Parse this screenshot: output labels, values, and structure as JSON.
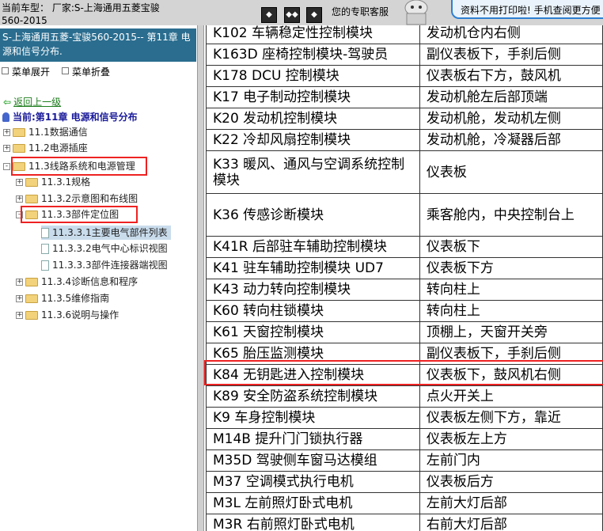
{
  "top_bar": {
    "vehicle_line1": "当前车型：  厂家:S-上海通用五菱宝骏",
    "vehicle_line2": "560-2015",
    "nav_buttons": [
      "first-page-icon",
      "prev-next-icon",
      "last-page-icon"
    ],
    "slogan": "您的专职客服",
    "promo_text": "资料不用打印啦! 手机查阅更方便"
  },
  "left_panel": {
    "chapter_title": "S-上海通用五菱-宝骏560-2015-- 第11章 电源和信号分布.",
    "expand_label": "菜单展开",
    "collapse_label": "菜单折叠",
    "back_label": "返回上一级",
    "current_label": "当前:第11章 电源和信号分布",
    "tree": [
      {
        "label": "11.1数据通信",
        "level": 0,
        "toggle": "+"
      },
      {
        "label": "11.2电源插座",
        "level": 0,
        "toggle": "+"
      },
      {
        "label": "11.3线路系统和电源管理",
        "level": 0,
        "toggle": "-"
      },
      {
        "label": "11.3.1规格",
        "level": 1,
        "toggle": "+"
      },
      {
        "label": "11.3.2示意图和布线图",
        "level": 1,
        "toggle": "+"
      },
      {
        "label": "11.3.3部件定位图",
        "level": 1,
        "toggle": "-"
      },
      {
        "label": "11.3.3.1主要电气部件列表",
        "level": 2,
        "toggle": ""
      },
      {
        "label": "11.3.3.2电气中心标识视图",
        "level": 2,
        "toggle": ""
      },
      {
        "label": "11.3.3.3部件连接器端视图",
        "level": 2,
        "toggle": ""
      },
      {
        "label": "11.3.4诊断信息和程序",
        "level": 1,
        "toggle": "+"
      },
      {
        "label": "11.3.5维修指南",
        "level": 1,
        "toggle": "+"
      },
      {
        "label": "11.3.6说明与操作",
        "level": 1,
        "toggle": "+"
      }
    ]
  },
  "component_table": {
    "rows": [
      {
        "component": "K102 车辆稳定性控制模块",
        "location": "发动机仓内右侧"
      },
      {
        "component": "K163D 座椅控制模块-驾驶员",
        "location": "副仪表板下，手刹后侧"
      },
      {
        "component": "K178 DCU 控制模块",
        "location": "仪表板右下方，鼓风机"
      },
      {
        "component": "K17 电子制动控制模块",
        "location": "发动机舱左后部顶端"
      },
      {
        "component": "K20 发动机控制模块",
        "location": "发动机舱，发动机左侧"
      },
      {
        "component": "K22 冷却风扇控制模块",
        "location": "发动机舱，冷凝器后部"
      },
      {
        "component": "K33 暖风、通风与空调系统控制模块",
        "location": "仪表板"
      },
      {
        "component": "K36 传感诊断模块",
        "location": "乘客舱内，中央控制台上"
      },
      {
        "component": "K41R 后部驻车辅助控制模块",
        "location": "仪表板下"
      },
      {
        "component": "K41 驻车辅助控制模块 UD7",
        "location": "仪表板下方"
      },
      {
        "component": "K43 动力转向控制模块",
        "location": "转向柱上"
      },
      {
        "component": "K60 转向柱锁模块",
        "location": "转向柱上"
      },
      {
        "component": "K61  天窗控制模块",
        "location": "顶棚上，天窗开关旁"
      },
      {
        "component": "K65  胎压监测模块",
        "location": "副仪表板下，手刹后侧"
      },
      {
        "component": "K84 无钥匙进入控制模块",
        "location": "仪表板下，鼓风机右侧"
      },
      {
        "component": "K89 安全防盗系统控制模块",
        "location": "点火开关上"
      },
      {
        "component": "K9 车身控制模块",
        "location": "仪表板左侧下方，靠近"
      },
      {
        "component": "M14B 提升门门锁执行器",
        "location": "仪表板左上方"
      },
      {
        "component": "M35D 驾驶侧车窗马达模组",
        "location": "左前门内"
      },
      {
        "component": "M37 空调模式执行电机",
        "location": "仪表板后方"
      },
      {
        "component": "M3L 左前照灯卧式电机",
        "location": "左前大灯后部"
      },
      {
        "component": "M3R 右前照灯卧式电机",
        "location": "右前大灯后部"
      }
    ]
  }
}
